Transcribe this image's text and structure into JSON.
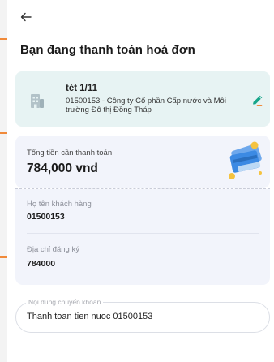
{
  "header": {
    "back_icon": "arrow-left-icon",
    "title": "Bạn đang thanh toán hoá đơn"
  },
  "bill": {
    "icon": "building-icon",
    "name": "tét 1/11",
    "detail": "01500153 - Công ty Cổ phần Cấp nước và Môi trường Đô thị Đồng Tháp",
    "edit_icon": "pencil-icon"
  },
  "amount": {
    "label": "Tổng tiền cần thanh toán",
    "value": "784,000 vnd",
    "illustration": "payment-card-illustration"
  },
  "customer": {
    "name_label": "Họ tên khách hàng",
    "name_value": "01500153",
    "address_label": "Địa chỉ đăng ký",
    "address_value": "784000"
  },
  "transfer_note": {
    "label": "Nội dung chuyển khoản",
    "value": "Thanh toan tien nuoc 01500153"
  },
  "colors": {
    "accent": "#f08a3a",
    "bill_card_bg": "#e7f3f3",
    "info_card_bg": "#f2f4fb",
    "edit_icon": "#17a589"
  }
}
